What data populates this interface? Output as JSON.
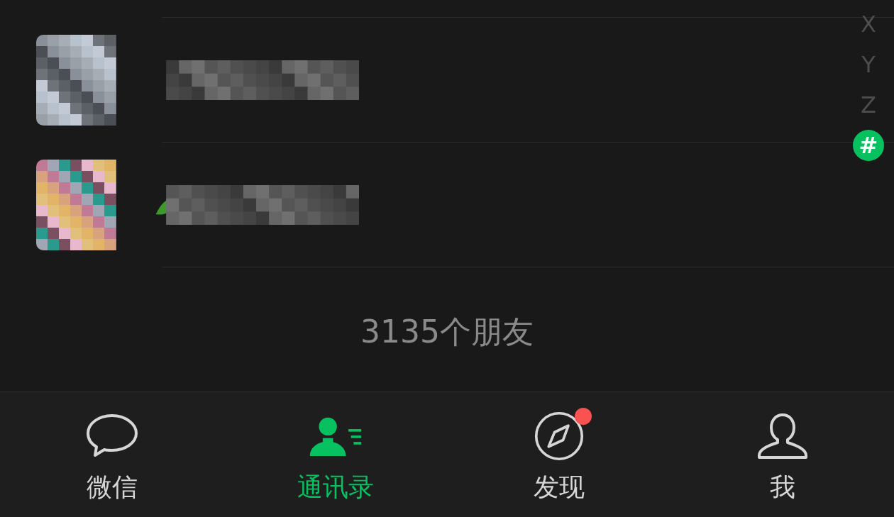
{
  "index": [
    {
      "label": "X",
      "selected": false
    },
    {
      "label": "Y",
      "selected": false
    },
    {
      "label": "Z",
      "selected": false
    },
    {
      "label": "#",
      "selected": true
    }
  ],
  "friend_count": "3135个朋友",
  "tabs": [
    {
      "kind": "chat",
      "label": "微信",
      "selected": false,
      "badge": false
    },
    {
      "kind": "contacts",
      "label": "通讯录",
      "selected": true,
      "badge": false
    },
    {
      "kind": "discover",
      "label": "发现",
      "selected": false,
      "badge": true
    },
    {
      "kind": "me",
      "label": "我",
      "selected": false,
      "badge": false
    }
  ]
}
